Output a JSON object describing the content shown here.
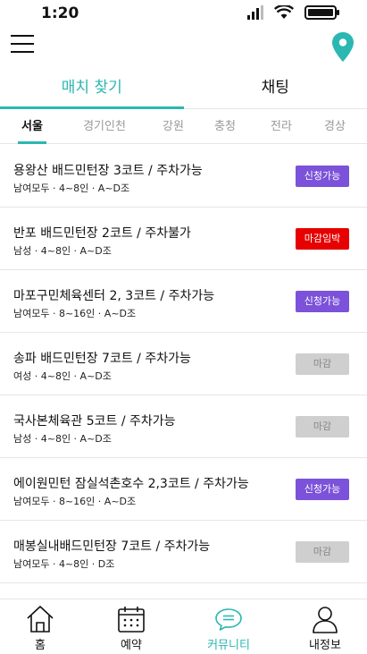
{
  "status_bar": {
    "time": "1:20"
  },
  "header": {
    "menu_icon": "hamburger-menu-icon",
    "map_icon": "location-pin-icon",
    "accent_color": "#2bb7b2"
  },
  "main_tabs": [
    {
      "label": "매치 찾기",
      "active": true
    },
    {
      "label": "채팅",
      "active": false
    }
  ],
  "region_tabs": [
    {
      "label": "서울",
      "active": true
    },
    {
      "label": "경기인천",
      "active": false
    },
    {
      "label": "강원",
      "active": false
    },
    {
      "label": "충청",
      "active": false
    },
    {
      "label": "전라",
      "active": false
    },
    {
      "label": "경상",
      "active": false
    }
  ],
  "matches": [
    {
      "title": "용왕산 배드민턴장 3코트 / 주차가능",
      "subtitle": "남여모두  ·  4~8인  ·  A~D조",
      "status": "신청가능",
      "status_color": "#7b52d9"
    },
    {
      "title": "반포 배드민턴장 2코트 / 주차불가",
      "subtitle": "남성  ·  4~8인  ·  A~D조",
      "status": "마감임박",
      "status_color": "#e60000"
    },
    {
      "title": "마포구민체육센터 2, 3코트 / 주차가능",
      "subtitle": "남여모두  ·  8~16인  ·  A~D조",
      "status": "신청가능",
      "status_color": "#7b52d9"
    },
    {
      "title": "송파 배드민턴장 7코트 / 주차가능",
      "subtitle": "여성  ·  4~8인  ·  A~D조",
      "status": "마감",
      "status_color": "#cfcfcf"
    },
    {
      "title": "국사본체육관 5코트 / 주차가능",
      "subtitle": "남성  ·  4~8인  ·  A~D조",
      "status": "마감",
      "status_color": "#cfcfcf"
    },
    {
      "title": "에이원민턴 잠실석촌호수 2,3코트 / 주차가능",
      "subtitle": "남여모두  ·  8~16인  ·  A~D조",
      "status": "신청가능",
      "status_color": "#7b52d9"
    },
    {
      "title": "매봉실내배드민턴장 7코트 / 주차가능",
      "subtitle": "남여모두  ·  4~8인  ·  D조",
      "status": "마감",
      "status_color": "#cfcfcf"
    }
  ],
  "bottom_nav": [
    {
      "label": "홈",
      "icon": "home-icon",
      "active": false
    },
    {
      "label": "예약",
      "icon": "calendar-icon",
      "active": false
    },
    {
      "label": "커뮤니티",
      "icon": "chat-bubble-icon",
      "active": true
    },
    {
      "label": "내정보",
      "icon": "person-icon",
      "active": false
    }
  ]
}
